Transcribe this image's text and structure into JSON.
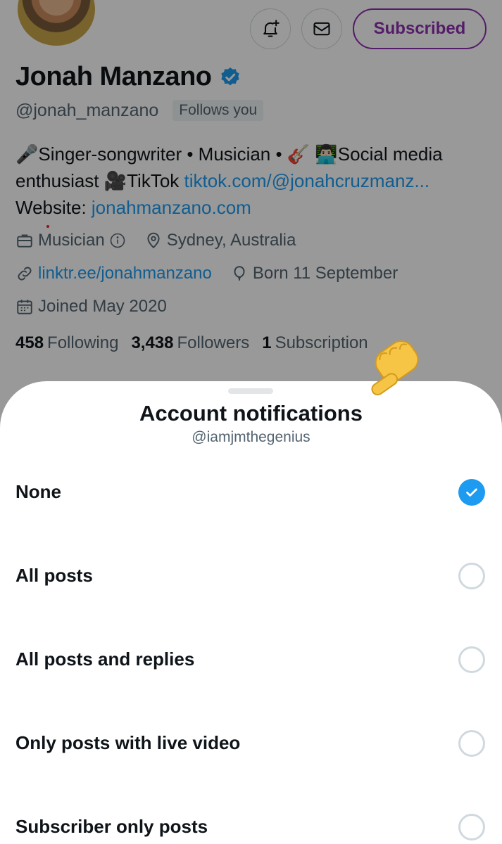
{
  "profile": {
    "buttons": {
      "subscribed_label": "Subscribed"
    },
    "name": "Jonah Manzano",
    "handle": "@jonah_manzano",
    "follows_you": "Follows you",
    "bio": {
      "line1": "🎤Singer-songwriter • Musician • 🎸 👨🏻‍💻Social media",
      "line2_text": "enthusiast 🎥TikTok ",
      "line2_link": "tiktok.com/@jonahcruzmanz...",
      "line3_text": "Website: ",
      "line3_link": "jonahmanzano.com"
    },
    "meta": {
      "category": "Musician",
      "location": "Sydney, Australia",
      "link": "linktr.ee/jonahmanzano",
      "birthday": "Born 11 September",
      "joined": "Joined May 2020"
    },
    "stats": {
      "following_count": "458",
      "following_label": "Following",
      "followers_count": "3,438",
      "followers_label": "Followers",
      "subscriptions_count": "1",
      "subscriptions_label": "Subscription"
    }
  },
  "sheet": {
    "title": "Account notifications",
    "subtitle": "@iamjmthegenius",
    "selected": "None",
    "options": [
      {
        "label": "None",
        "checked": true
      },
      {
        "label": "All posts",
        "checked": false
      },
      {
        "label": "All posts and replies",
        "checked": false
      },
      {
        "label": "Only posts with live video",
        "checked": false
      },
      {
        "label": "Subscriber only posts",
        "checked": false
      }
    ]
  },
  "colors": {
    "accent": "#1d9bf0",
    "subscribe": "#8e2fb0",
    "muted": "#536471"
  },
  "icons": [
    "bell-plus-icon",
    "mail-icon",
    "verified-badge-icon",
    "briefcase-icon",
    "info-icon",
    "location-pin-icon",
    "link-icon",
    "balloon-icon",
    "calendar-icon",
    "checkmark-icon",
    "pointing-hand-emoji"
  ]
}
